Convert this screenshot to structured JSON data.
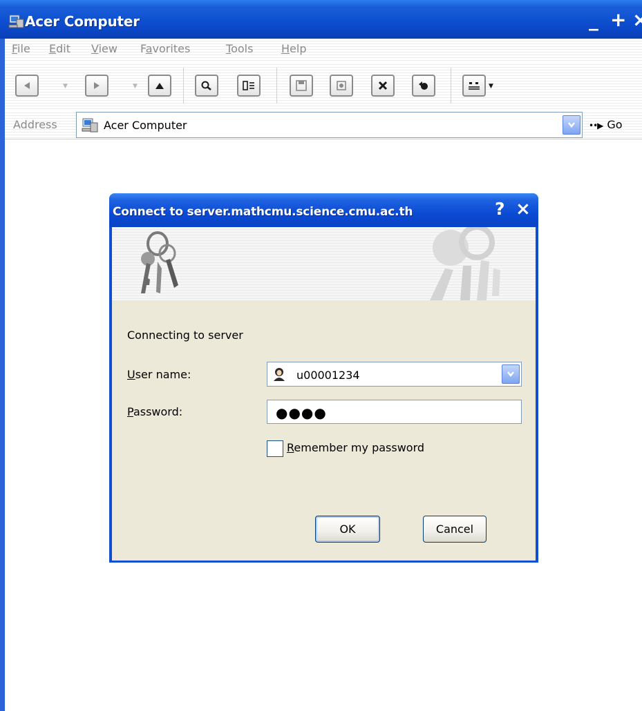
{
  "window": {
    "title": "Acer Computer",
    "controls": {
      "minimize": "_",
      "maximize": "+",
      "close": "×"
    }
  },
  "menu": {
    "items": [
      {
        "label": "File",
        "access": "F"
      },
      {
        "label": "Edit",
        "access": "E"
      },
      {
        "label": "View",
        "access": "V"
      },
      {
        "label": "Favorites",
        "access": "a"
      },
      {
        "label": "Tools",
        "access": "T"
      },
      {
        "label": "Help",
        "access": "H"
      }
    ]
  },
  "toolbar": {
    "buttons": [
      "back-icon",
      "forward-icon",
      "up-icon",
      "search-icon",
      "folders-icon",
      "save-icon",
      "copy-to-icon",
      "delete-icon",
      "undo-icon",
      "views-icon"
    ]
  },
  "address": {
    "label": "Address",
    "value": "Acer Computer",
    "go_label": "Go"
  },
  "dialog": {
    "title": "Connect to server.mathcmu.science.cmu.ac.th",
    "help": "?",
    "close": "×",
    "message": "Connecting to server",
    "user_label_access": "U",
    "user_label_rest": "ser name:",
    "user_value": "u00001234",
    "password_label_access": "P",
    "password_label_rest": "assword:",
    "password_value": "●●●●",
    "remember_access": "R",
    "remember_rest": "emember my password",
    "remember_checked": false,
    "ok_label": "OK",
    "cancel_label": "Cancel"
  },
  "colors": {
    "titlebar": "#0d4fd0",
    "dialog_face": "#ece9d8",
    "disabled_text": "#8a8a8a"
  }
}
